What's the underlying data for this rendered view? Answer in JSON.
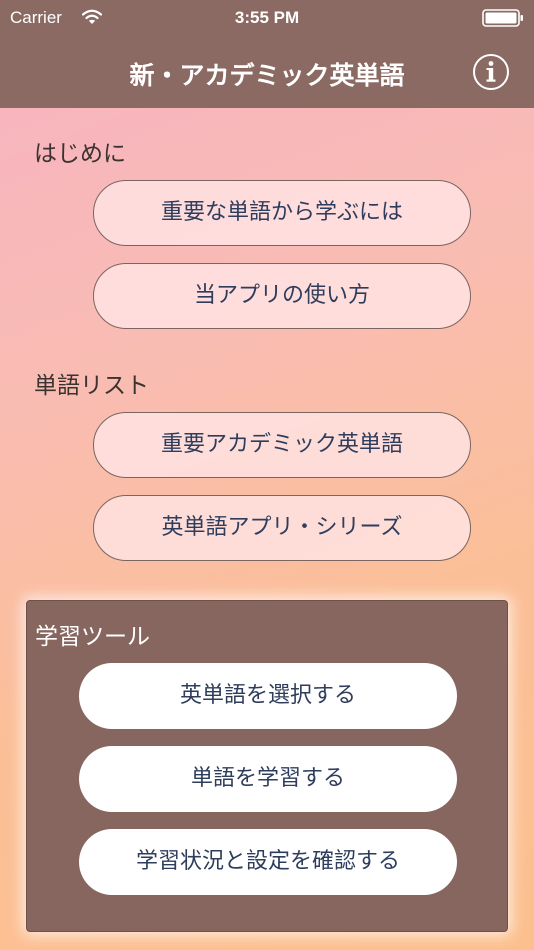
{
  "status_bar": {
    "carrier": "Carrier",
    "time": "3:55 PM"
  },
  "nav": {
    "title": "新・アカデミック英単語",
    "info_icon": "info-circle-icon"
  },
  "sections": {
    "intro_label": "はじめに",
    "intro_buttons": [
      "重要な単語から学ぶには",
      "当アプリの使い方"
    ],
    "list_label": "単語リスト",
    "list_buttons": [
      "重要アカデミック英単語",
      "英単語アプリ・シリーズ"
    ],
    "tools_label": "学習ツール",
    "tools_buttons": [
      "英単語を選択する",
      "単語を学習する",
      "学習状況と設定を確認する"
    ]
  },
  "colors": {
    "nav_background": "#8a6a63",
    "panel_background": "#86665f",
    "button_text": "#2f3d5c",
    "gradient_start": "#f7b2c3",
    "gradient_end": "#fcc08e"
  }
}
